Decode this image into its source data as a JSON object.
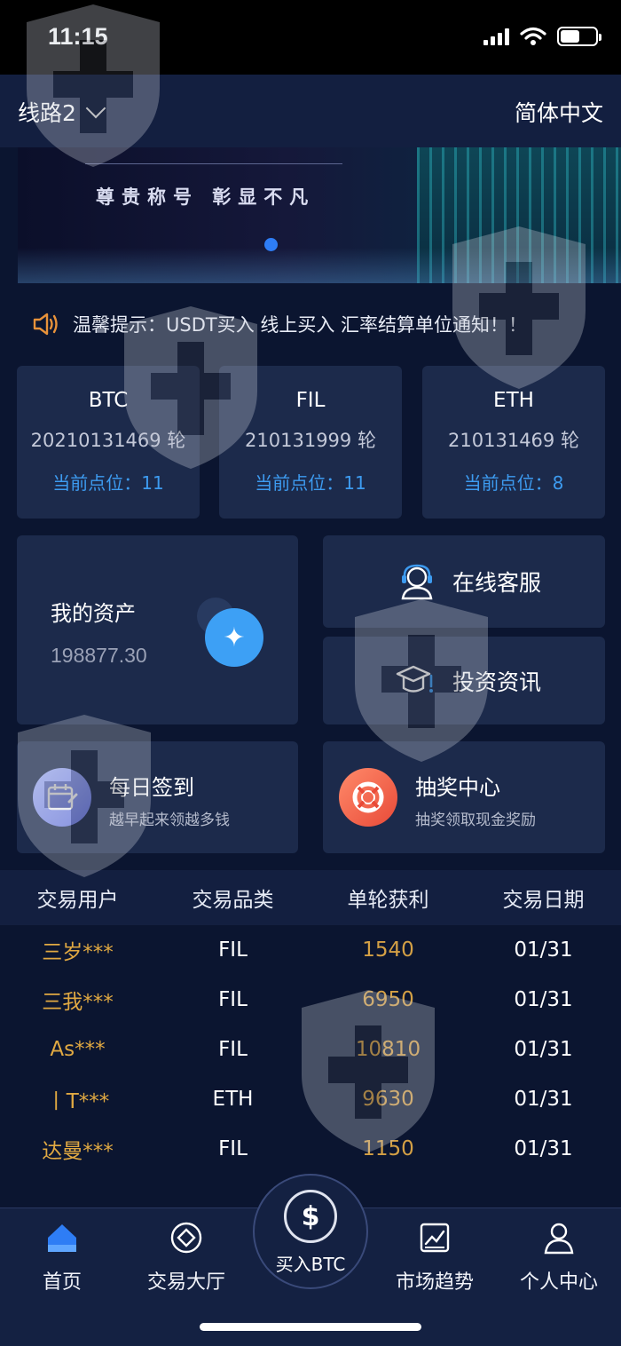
{
  "status_bar": {
    "time": "11:15"
  },
  "header": {
    "route_label": "线路2",
    "language": "简体中文"
  },
  "banner": {
    "slogan": "尊贵称号  彰显不凡"
  },
  "notice": {
    "text": "温馨提示：USDT买入 线上买入 汇率结算单位通知！！"
  },
  "coins": [
    {
      "name": "BTC",
      "round": "20210131469 轮",
      "position": "当前点位：11"
    },
    {
      "name": "FIL",
      "round": "210131999 轮",
      "position": "当前点位：11"
    },
    {
      "name": "ETH",
      "round": "210131469 轮",
      "position": "当前点位：8"
    }
  ],
  "asset": {
    "title": "我的资产",
    "value": "198877.30"
  },
  "services": {
    "support": "在线客服",
    "news": "投资资讯"
  },
  "promos": {
    "checkin": {
      "title": "每日签到",
      "subtitle": "越早起来领越多钱"
    },
    "lottery": {
      "title": "抽奖中心",
      "subtitle": "抽奖领取现金奖励"
    }
  },
  "table": {
    "headers": [
      "交易用户",
      "交易品类",
      "单轮获利",
      "交易日期"
    ],
    "rows": [
      [
        "三岁***",
        "FIL",
        "1540",
        "01/31"
      ],
      [
        "三我***",
        "FIL",
        "6950",
        "01/31"
      ],
      [
        "As***",
        "FIL",
        "10810",
        "01/31"
      ],
      [
        "丨T***",
        "ETH",
        "9630",
        "01/31"
      ],
      [
        "达曼***",
        "FIL",
        "1150",
        "01/31"
      ]
    ]
  },
  "tabs": {
    "home": "首页",
    "hall": "交易大厅",
    "buy": "买入BTC",
    "market": "市场趋势",
    "profile": "个人中心"
  },
  "colors": {
    "background": "#0b1530",
    "card": "#1c2a4b",
    "accent_blue": "#3d9bf0",
    "gold": "#d4a045",
    "tab_active": "#2e7df5"
  },
  "icons": [
    "signal-icon",
    "wifi-icon",
    "battery-icon",
    "chevron-down-icon",
    "speaker-icon",
    "star-badge-icon",
    "headset-icon",
    "graduation-cap-icon",
    "calendar-icon",
    "lifebuoy-icon",
    "home-icon",
    "coin-icon",
    "dollar-coin-icon",
    "chart-icon",
    "person-icon"
  ]
}
